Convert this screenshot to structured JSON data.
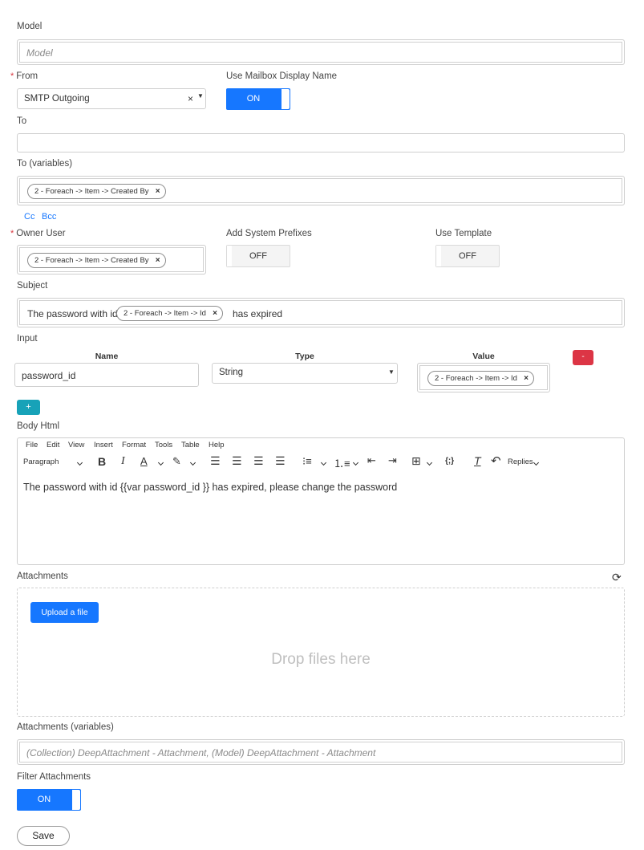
{
  "model": {
    "label": "Model",
    "placeholder": "Model"
  },
  "from": {
    "label": "From",
    "value": "SMTP Outgoing"
  },
  "use_mailbox_display_name": {
    "label": "Use Mailbox Display Name",
    "state": "ON"
  },
  "to": {
    "label": "To",
    "value": ""
  },
  "to_variables": {
    "label": "To (variables)",
    "chips": [
      "2 - Foreach -> Item -> Created By"
    ]
  },
  "cc_link": "Cc",
  "bcc_link": "Bcc",
  "owner_user": {
    "label": "Owner User",
    "chip": "2 - Foreach -> Item -> Created By"
  },
  "add_system_prefixes": {
    "label": "Add System Prefixes",
    "state": "OFF"
  },
  "use_template": {
    "label": "Use Template",
    "state": "OFF"
  },
  "subject": {
    "label": "Subject",
    "before": "The password with id",
    "chip": "2 - Foreach -> Item -> Id",
    "after": "has expired"
  },
  "input": {
    "label": "Input",
    "headers": {
      "name": "Name",
      "type": "Type",
      "value": "Value"
    },
    "row": {
      "name": "password_id",
      "type": "String",
      "value_chip": "2 - Foreach -> Item -> Id"
    },
    "remove_label": "-",
    "add_label": "+"
  },
  "body_html": {
    "label": "Body Html",
    "menu": [
      "File",
      "Edit",
      "View",
      "Insert",
      "Format",
      "Tools",
      "Table",
      "Help"
    ],
    "block_format": "Paragraph",
    "replies_label": "Replies",
    "content": "The password with id {{var password_id }} has expired, please change the password"
  },
  "attachments": {
    "label": "Attachments",
    "upload_label": "Upload a file",
    "drop_text": "Drop files here"
  },
  "attachments_variables": {
    "label": "Attachments (variables)",
    "placeholder": "(Collection) DeepAttachment - Attachment, (Model) DeepAttachment - Attachment"
  },
  "filter_attachments": {
    "label": "Filter Attachments",
    "state": "ON"
  },
  "save_label": "Save",
  "colors": {
    "primary": "#1677ff",
    "teal": "#17a2b8",
    "danger": "#dc3545",
    "required": "#d9363e"
  }
}
